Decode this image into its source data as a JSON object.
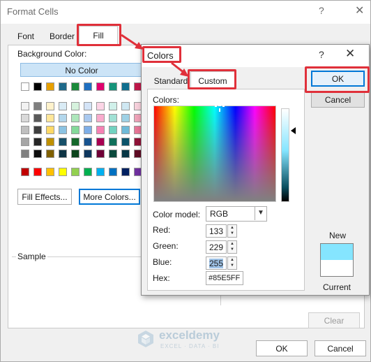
{
  "format_cells": {
    "title": "Format Cells",
    "help_glyph": "?",
    "close_glyph": "✕",
    "tabs": [
      "Font",
      "Border",
      "Fill"
    ],
    "background_color_label": "Background Color:",
    "no_color_label": "No Color",
    "theme_row": [
      "#ffffff",
      "#000000",
      "#e7a000",
      "#1f6a8a",
      "#1b8a3a",
      "#1f6fc0",
      "#e0006e",
      "#16947a",
      "#0f6e8e",
      "#c0184a",
      "#c86810"
    ],
    "theme_grid": [
      [
        "#f2f2f2",
        "#7f7f7f",
        "#fff2cc",
        "#d9ebf5",
        "#d6f2dd",
        "#d4e4f7",
        "#fcd5e6",
        "#d0f0ea",
        "#cfe8f2",
        "#f7d1dc",
        "#fbe1cc"
      ],
      [
        "#d9d9d9",
        "#595959",
        "#ffe699",
        "#b3d7ec",
        "#ade6bb",
        "#a9c9ef",
        "#f9abcd",
        "#a1e1d5",
        "#9fd1e5",
        "#efa3b9",
        "#f7c39a"
      ],
      [
        "#bfbfbf",
        "#3f3f3f",
        "#ffd966",
        "#8cc3e2",
        "#84d99a",
        "#7eaee7",
        "#f681b4",
        "#72d2c0",
        "#6fbad8",
        "#e77596",
        "#f3a567"
      ],
      [
        "#a6a6a6",
        "#262626",
        "#bf9000",
        "#175068",
        "#14672b",
        "#17538f",
        "#a80052",
        "#10705b",
        "#0b536a",
        "#901237",
        "#964e0c"
      ],
      [
        "#808080",
        "#0d0d0d",
        "#806000",
        "#0f3545",
        "#0d451d",
        "#0f375f",
        "#700037",
        "#0b4a3d",
        "#073746",
        "#600c25",
        "#643408"
      ]
    ],
    "standard_row": [
      "#c00000",
      "#ff0000",
      "#ffc000",
      "#ffff00",
      "#92d050",
      "#00b050",
      "#00b0f0",
      "#0070c0",
      "#002060",
      "#7030a0"
    ],
    "fill_effects_button": "Fill Effects...",
    "more_colors_button": "More Colors...",
    "sample_label": "Sample",
    "clear_button": "Clear",
    "ok_button": "OK",
    "cancel_button": "Cancel"
  },
  "colors_dialog": {
    "title": "Colors",
    "help_glyph": "?",
    "close_glyph": "✕",
    "tabs": [
      "Standard",
      "Custom"
    ],
    "colors_label": "Colors:",
    "color_model_label": "Color model:",
    "color_model_value": "RGB",
    "red_label": "Red:",
    "red_value": "133",
    "green_label": "Green:",
    "green_value": "229",
    "blue_label": "Blue:",
    "blue_value": "255",
    "hex_label": "Hex:",
    "hex_value": "#85E5FF",
    "ok_button": "OK",
    "cancel_button": "Cancel",
    "new_label": "New",
    "current_label": "Current",
    "new_color": "#85e5ff",
    "current_color": "#ffffff"
  },
  "annotation_color": "#e0303a",
  "watermark": {
    "name": "exceldemy",
    "tagline": "EXCEL · DATA · BI"
  }
}
